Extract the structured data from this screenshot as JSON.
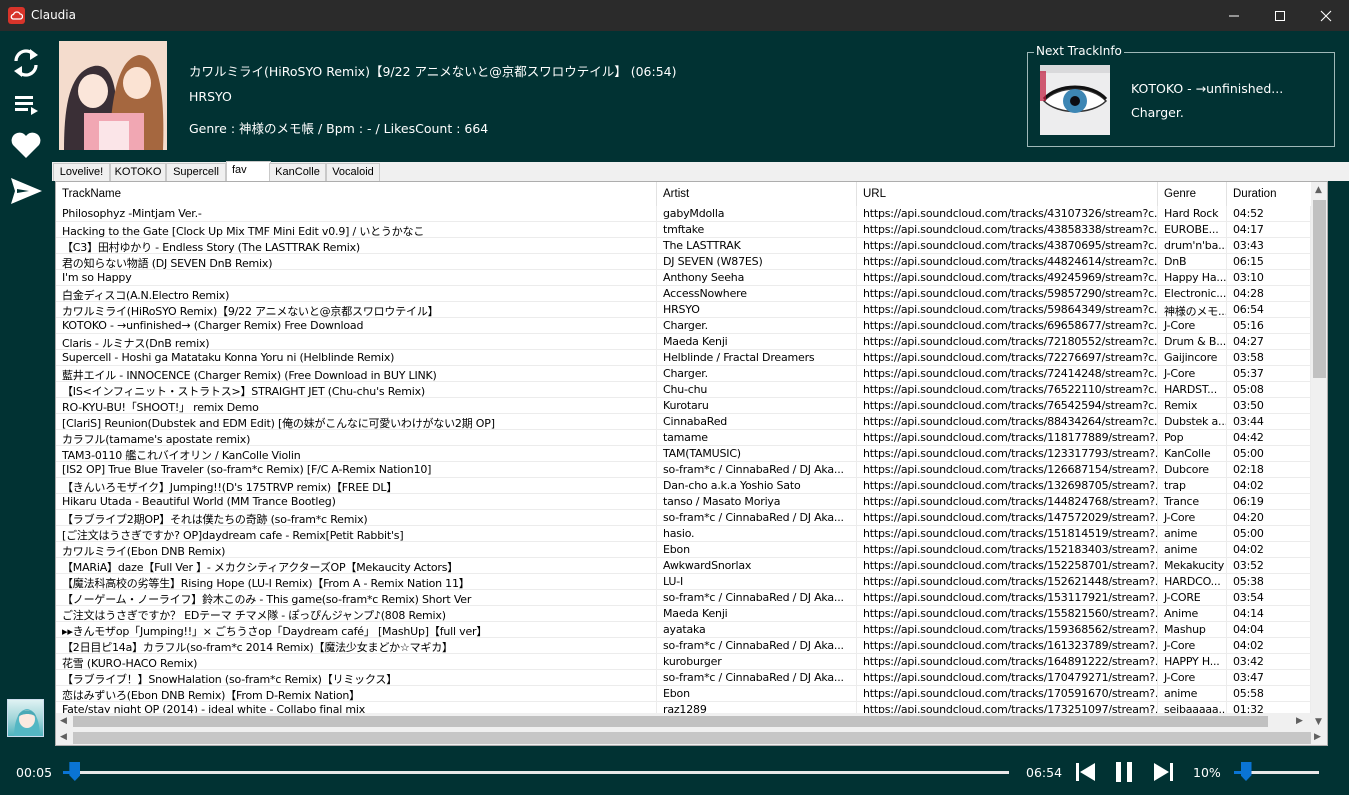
{
  "window": {
    "title": "Claudia"
  },
  "colors": {
    "accent": "#0a74d4",
    "background": "#013233",
    "titlebar": "#2b2b2b"
  },
  "sidebar": {
    "icons": [
      "sync-icon",
      "playlist-icon",
      "heart-icon",
      "send-icon"
    ]
  },
  "now_playing": {
    "title": "カワルミライ(HiRoSYO Remix)【9/22 アニメないと@京都スワロウテイル】 (06:54)",
    "artist": "HRSYO",
    "info": "Genre : 神様のメモ帳 / Bpm : - / LikesCount : 664"
  },
  "next_track": {
    "legend": "Next TrackInfo",
    "title": "KOTOKO - →unfinished...",
    "artist": "Charger."
  },
  "tabs": [
    {
      "label": "Lovelive!"
    },
    {
      "label": "KOTOKO"
    },
    {
      "label": "Supercell"
    },
    {
      "label": "fav"
    },
    {
      "label": "KanColle"
    },
    {
      "label": "Vocaloid"
    }
  ],
  "grid": {
    "columns": [
      "TrackName",
      "Artist",
      "URL",
      "Genre",
      "Duration"
    ],
    "rows": [
      [
        "Philosophyz -Mintjam Ver.-",
        "gabyMdolla",
        "https://api.soundcloud.com/tracks/43107326/stream?c...",
        "Hard Rock",
        "04:52"
      ],
      [
        "Hacking to the Gate [Clock Up Mix TMF Mini Edit v0.9] / いとうかなこ",
        "tmftake",
        "https://api.soundcloud.com/tracks/43858338/stream?c...",
        "EUROBE...",
        "04:17"
      ],
      [
        "【C3】田村ゆかり - Endless Story (The LASTTRAK Remix)",
        "The LASTTRAK",
        "https://api.soundcloud.com/tracks/43870695/stream?c...",
        "drum'n'ba...",
        "03:43"
      ],
      [
        "君の知らない物語 (DJ SEVEN DnB Remix)",
        "DJ SEVEN (W87ES)",
        "https://api.soundcloud.com/tracks/44824614/stream?c...",
        "DnB",
        "06:15"
      ],
      [
        "I'm so Happy",
        "Anthony Seeha",
        "https://api.soundcloud.com/tracks/49245969/stream?c...",
        "Happy Ha...",
        "03:10"
      ],
      [
        "白金ディスコ(A.N.Electro Remix)",
        "AccessNowhere",
        "https://api.soundcloud.com/tracks/59857290/stream?c...",
        "Electronic...",
        "04:28"
      ],
      [
        "カワルミライ(HiRoSYO Remix)【9/22 アニメないと@京都スワロウテイル】",
        "HRSYO",
        "https://api.soundcloud.com/tracks/59864349/stream?c...",
        "神様のメモ...",
        "06:54"
      ],
      [
        "KOTOKO - →unfinished→ (Charger Remix) Free Download",
        "Charger.",
        "https://api.soundcloud.com/tracks/69658677/stream?c...",
        "J-Core",
        "05:16"
      ],
      [
        "Claris - ルミナス(DnB remix)",
        "Maeda Kenji",
        "https://api.soundcloud.com/tracks/72180552/stream?c...",
        "Drum & B...",
        "04:27"
      ],
      [
        "Supercell - Hoshi ga Matataku Konna Yoru ni (Helblinde Remix)",
        "Helblinde / Fractal Dreamers",
        "https://api.soundcloud.com/tracks/72276697/stream?c...",
        "Gaijincore",
        "03:58"
      ],
      [
        "藍井エイル - INNOCENCE (Charger Remix) (Free Download in BUY LINK)",
        "Charger.",
        "https://api.soundcloud.com/tracks/72414248/stream?c...",
        "J-Core",
        "05:37"
      ],
      [
        "【IS<インフィニット・ストラトス>】STRAIGHT JET (Chu-chu's Remix)",
        "Chu-chu",
        "https://api.soundcloud.com/tracks/76522110/stream?c...",
        "HARDST...",
        "05:08"
      ],
      [
        "RO-KYU-BU!「SHOOT!」 remix Demo",
        "Kurotaru",
        "https://api.soundcloud.com/tracks/76542594/stream?c...",
        "Remix",
        "03:50"
      ],
      [
        "[ClariS] Reunion(Dubstek and EDM Edit) [俺の妹がこんなに可愛いわけがない2期 OP]",
        "CinnabaRed",
        "https://api.soundcloud.com/tracks/88434264/stream?c...",
        "Dubstek a...",
        "03:44"
      ],
      [
        "カラフル(tamame's apostate remix)",
        "tamame",
        "https://api.soundcloud.com/tracks/118177889/stream?...",
        "Pop",
        "04:42"
      ],
      [
        "TAM3-0110 艦これバイオリン / KanColle Violin",
        "TAM(TAMUSIC)",
        "https://api.soundcloud.com/tracks/123317793/stream?...",
        "KanColle",
        "05:00"
      ],
      [
        "[IS2 OP] True Blue Traveler (so-fram*c Remix) [F/C A-Remix Nation10]",
        "so-fram*c / CinnabaRed / DJ Aka...",
        "https://api.soundcloud.com/tracks/126687154/stream?...",
        "Dubcore",
        "02:18"
      ],
      [
        "【きんいろモザイク】Jumping!!(D's 175TRVP remix)【FREE DL】",
        "Dan-cho a.k.a Yoshio Sato",
        "https://api.soundcloud.com/tracks/132698705/stream?...",
        "trap",
        "04:02"
      ],
      [
        "Hikaru Utada - Beautiful World (MM Trance Bootleg)",
        "tanso / Masato Moriya",
        "https://api.soundcloud.com/tracks/144824768/stream?...",
        "Trance",
        "06:19"
      ],
      [
        "【ラブライブ2期OP】それは僕たちの奇跡 (so-fram*c Remix)",
        "so-fram*c / CinnabaRed / DJ Aka...",
        "https://api.soundcloud.com/tracks/147572029/stream?...",
        "J-Core",
        "04:20"
      ],
      [
        "[ご注文はうさぎですか? OP]daydream cafe - Remix[Petit Rabbit's]",
        "hasio.",
        "https://api.soundcloud.com/tracks/151814519/stream?...",
        "anime",
        "05:00"
      ],
      [
        "カワルミライ(Ebon DNB Remix)",
        "Ebon",
        "https://api.soundcloud.com/tracks/152183403/stream?...",
        "anime",
        "04:02"
      ],
      [
        "【MARiA】daze【Full Ver 】- メカクシティアクターズOP【Mekaucity Actors】",
        "AwkwardSnorlax",
        "https://api.soundcloud.com/tracks/152258701/stream?...",
        "Mekakucity",
        "03:52"
      ],
      [
        "【魔法科高校の劣等生】Rising Hope (LU-I Remix)【From A - Remix Nation 11】",
        "LU-I",
        "https://api.soundcloud.com/tracks/152621448/stream?...",
        "HARDCO...",
        "05:38"
      ],
      [
        "【ノーゲーム・ノーライフ】鈴木このみ - This game(so-fram*c Remix) Short Ver",
        "so-fram*c / CinnabaRed / DJ Aka...",
        "https://api.soundcloud.com/tracks/153117921/stream?...",
        "J-CORE",
        "03:54"
      ],
      [
        "ご注文はうさぎですか？ EDテーマ チマメ隊 - ぽっぴんジャンプ♪(808 Remix)",
        "Maeda Kenji",
        "https://api.soundcloud.com/tracks/155821560/stream?...",
        "Anime",
        "04:14"
      ],
      [
        "▸▸きんモザop「Jumping!!」× ごちうさop「Daydream café」 [MashUp]【full ver】",
        "ayataka",
        "https://api.soundcloud.com/tracks/159368562/stream?...",
        "Mashup",
        "04:04"
      ],
      [
        "【2日目ピ14a】カラフル(so-fram*c 2014 Remix)【魔法少女まどか☆マギカ】",
        "so-fram*c / CinnabaRed / DJ Aka...",
        "https://api.soundcloud.com/tracks/161323789/stream?...",
        "J-Core",
        "04:02"
      ],
      [
        "花雪 (KURO-HACO Remix)",
        "kuroburger",
        "https://api.soundcloud.com/tracks/164891222/stream?...",
        "HAPPY H...",
        "03:42"
      ],
      [
        "【ラブライブ！】SnowHalation (so-fram*c Remix)【リミックス】",
        "so-fram*c / CinnabaRed / DJ Aka...",
        "https://api.soundcloud.com/tracks/170479271/stream?...",
        "J-Core",
        "03:47"
      ],
      [
        "恋はみずいろ(Ebon DNB Remix)【From D-Remix Nation】",
        "Ebon",
        "https://api.soundcloud.com/tracks/170591670/stream?...",
        "anime",
        "05:58"
      ],
      [
        "Fate/stay night OP (2014) - ideal white - Collabo final mix",
        "raz1289",
        "https://api.soundcloud.com/tracks/173251097/stream?...",
        "seibaaaaa...",
        "01:32"
      ]
    ]
  },
  "player": {
    "position": "00:05",
    "duration": "06:54",
    "progress_percent": 1.2,
    "volume_label": "10%",
    "volume_percent": 10
  }
}
